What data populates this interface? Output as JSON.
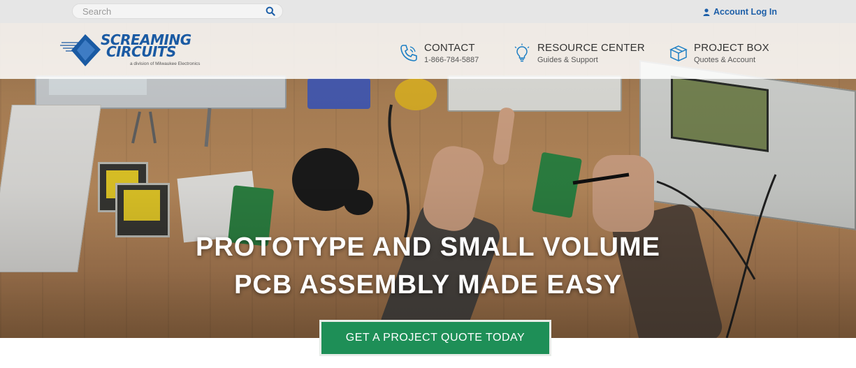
{
  "search": {
    "placeholder": "Search",
    "icon": "search-icon"
  },
  "account": {
    "label": "Account Log In",
    "icon": "user-icon"
  },
  "logo": {
    "line1": "SCREAMING",
    "line2": "CIRCUITS",
    "tagline": "a division of Milwaukee Electronics"
  },
  "nav": {
    "contact": {
      "title": "CONTACT",
      "sub": "1-866-784-5887",
      "icon": "phone-icon"
    },
    "resource": {
      "title": "RESOURCE CENTER",
      "sub": "Guides & Support",
      "icon": "lightbulb-icon"
    },
    "project_box": {
      "title": "PROJECT BOX",
      "sub": "Quotes & Account",
      "icon": "box-icon"
    }
  },
  "hero": {
    "headline_line1": "PROTOTYPE AND SMALL VOLUME",
    "headline_line2": "PCB ASSEMBLY MADE EASY",
    "cta_label": "GET A PROJECT QUOTE TODAY"
  },
  "colors": {
    "brand_blue": "#1a5aa3",
    "cta_green": "#1e8f57",
    "link_blue": "#1d5fa8"
  }
}
